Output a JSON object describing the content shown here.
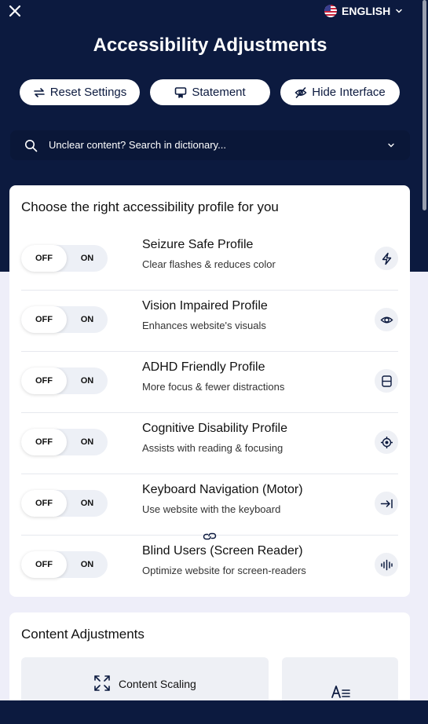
{
  "header": {
    "language": "ENGLISH",
    "title": "Accessibility Adjustments"
  },
  "actions": {
    "reset": "Reset Settings",
    "statement": "Statement",
    "hide": "Hide Interface"
  },
  "search": {
    "placeholder": "Unclear content? Search in dictionary..."
  },
  "profiles": {
    "heading": "Choose the right accessibility profile for you",
    "off_label": "OFF",
    "on_label": "ON",
    "items": [
      {
        "name": "Seizure Safe Profile",
        "desc": "Clear flashes & reduces color",
        "icon": "bolt-icon"
      },
      {
        "name": "Vision Impaired Profile",
        "desc": "Enhances website's visuals",
        "icon": "eye-icon"
      },
      {
        "name": "ADHD Friendly Profile",
        "desc": "More focus & fewer distractions",
        "icon": "focus-frame-icon"
      },
      {
        "name": "Cognitive Disability Profile",
        "desc": "Assists with reading & focusing",
        "icon": "target-icon"
      },
      {
        "name": "Keyboard Navigation (Motor)",
        "desc": "Use website with the keyboard",
        "icon": "tab-arrow-icon"
      },
      {
        "name": "Blind Users (Screen Reader)",
        "desc": "Optimize website for screen-readers",
        "icon": "audio-wave-icon"
      }
    ]
  },
  "content": {
    "heading": "Content Adjustments",
    "tiles": [
      {
        "label": "Content Scaling",
        "icon": "expand-icon"
      },
      {
        "label": "",
        "icon": "readable-font-icon"
      }
    ]
  },
  "colors": {
    "navy": "#0c1a3f",
    "page_bg": "#eeeef9",
    "card_bg": "#ffffff"
  }
}
